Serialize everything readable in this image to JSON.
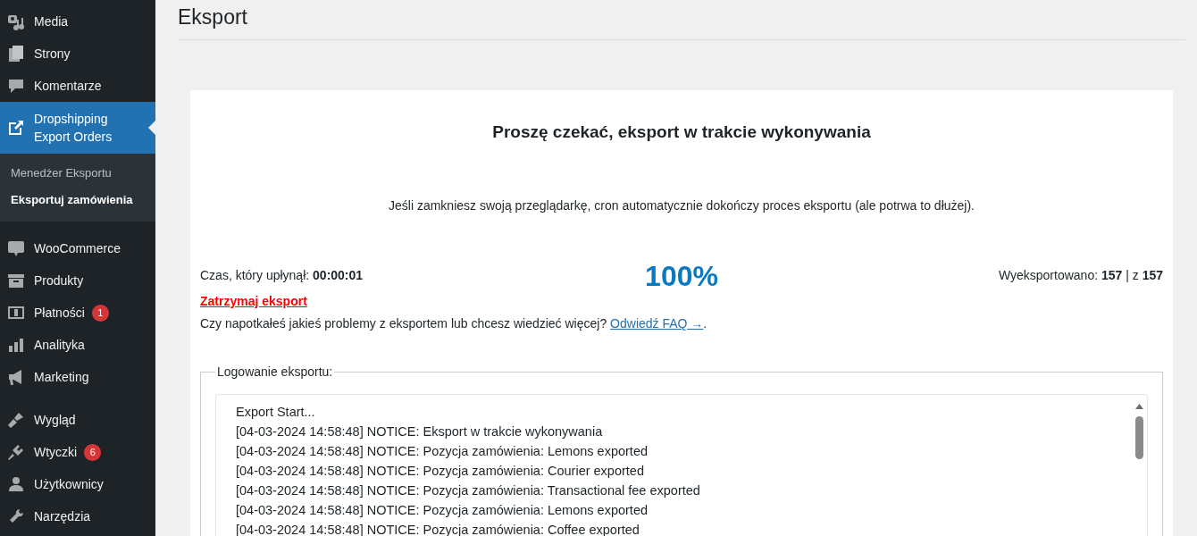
{
  "sidebar": {
    "groups": [
      {
        "items": [
          {
            "label": "Media",
            "selected": false
          },
          {
            "label": "Strony",
            "selected": false
          },
          {
            "label": "Komentarze",
            "selected": false
          },
          {
            "label": "Dropshipping Export Orders",
            "selected": true,
            "submenu": [
              {
                "label": "Menedżer Eksportu",
                "selected": false
              },
              {
                "label": "Eksportuj zamówienia",
                "selected": true
              }
            ]
          }
        ]
      },
      {
        "items": [
          {
            "label": "WooCommerce",
            "selected": false
          },
          {
            "label": "Produkty",
            "selected": false
          },
          {
            "label": "Płatności",
            "selected": false,
            "badge": "1"
          },
          {
            "label": "Analityka",
            "selected": false
          },
          {
            "label": "Marketing",
            "selected": false
          }
        ]
      },
      {
        "items": [
          {
            "label": "Wygląd",
            "selected": false
          },
          {
            "label": "Wtyczki",
            "selected": false,
            "badge": "6"
          },
          {
            "label": "Użytkownicy",
            "selected": false
          },
          {
            "label": "Narzędzia",
            "selected": false
          }
        ]
      }
    ]
  },
  "page_title": "Eksport",
  "panel": {
    "heading": "Proszę czekać, eksport w trakcie wykonywania",
    "note": "Jeśli zamkniesz swoją przeglądarkę, cron automatycznie dokończy proces eksportu (ale potrwa to dłużej).",
    "elapsed": "Czas, który upłynął: **00:00:01**",
    "percent": "100%",
    "exported": "Wyeksportowano: **157** | z **157**",
    "stop_link": "Zatrzymaj eksport",
    "faq_text": "Czy napotkałeś jakieś problemy z eksportem lub chcesz wiedzieć więcej?",
    "faq_link": "Odwiedź FAQ →",
    "faq_end": ".",
    "log": {
      "legend": "Logowanie eksportu:",
      "lines": [
        "Export Start...",
        "[04-03-2024 14:58:48] NOTICE: Eksport w trakcie wykonywania",
        "[04-03-2024 14:58:48] NOTICE: Pozycja zamówienia: Lemons exported",
        "[04-03-2024 14:58:48] NOTICE: Pozycja zamówienia: Courier exported",
        "[04-03-2024 14:58:48] NOTICE: Pozycja zamówienia: Transactional fee exported",
        "[04-03-2024 14:58:48] NOTICE: Pozycja zamówienia: Lemons exported",
        "[04-03-2024 14:58:48] NOTICE: Pozycja zamówienia: Coffee exported"
      ]
    }
  }
}
